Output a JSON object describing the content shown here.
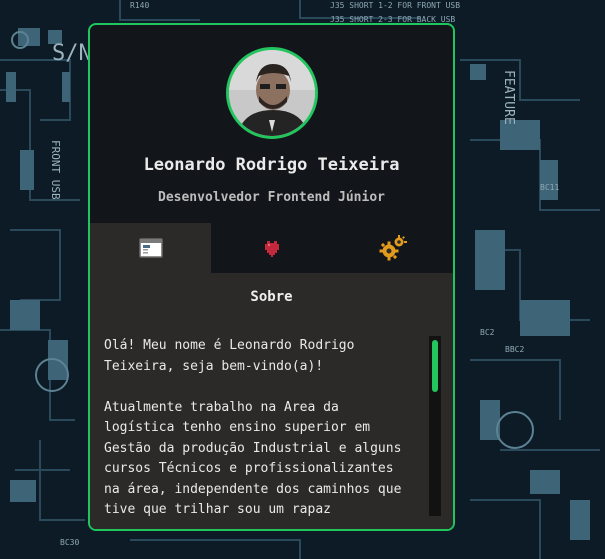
{
  "profile": {
    "name": "Leonardo Rodrigo Teixeira",
    "role": "Desenvolvedor Frontend Júnior"
  },
  "tabs": [
    {
      "icon": "window-icon",
      "active": true
    },
    {
      "icon": "heart-icon",
      "active": false
    },
    {
      "icon": "gears-icon",
      "active": false
    }
  ],
  "panel": {
    "title": "Sobre",
    "text": "Olá! Meu nome é Leonardo Rodrigo\nTeixeira, seja bem-vindo(a)!\n\nAtualmente trabalho na Area da\nlogística tenho ensino superior em\nGestão da produção Industrial e alguns\ncursos Técnicos e profissionalizantes\nna área, independente dos caminhos que\ntive que trilhar sou um rapaz"
  },
  "background_labels": [
    "J35 SHORT 1-2 FOR FRONT USB",
    "J35 SHORT 2-3 FOR BACK USB",
    "FRONT USB",
    "FEATURE",
    "R140",
    "S/N",
    "BC11",
    "BC2",
    "BC30"
  ],
  "colors": {
    "accent": "#22c55e",
    "card": "#121519",
    "panel": "#2b2a28"
  }
}
